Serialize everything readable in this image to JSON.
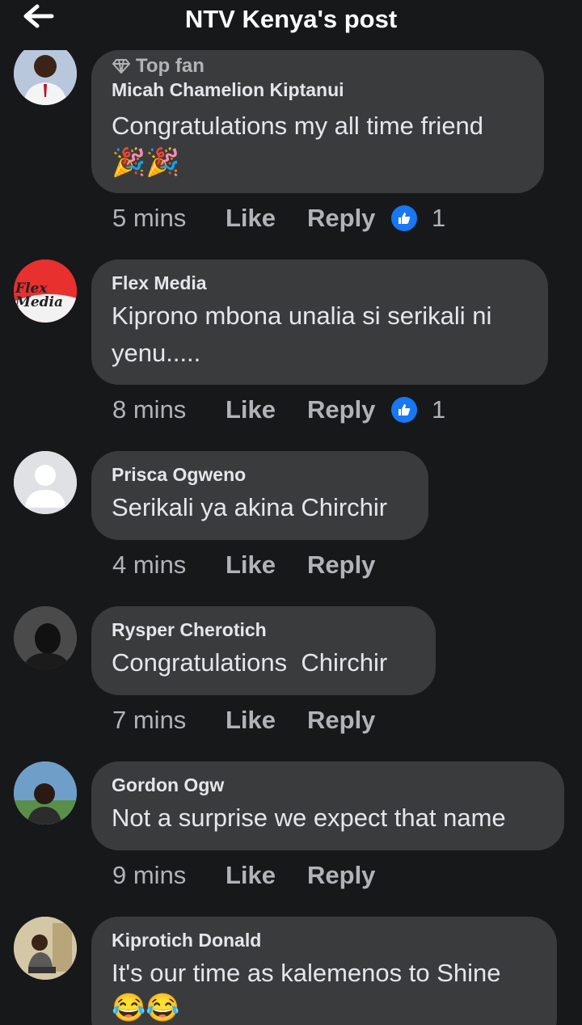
{
  "header": {
    "title": "NTV Kenya's post",
    "back_icon": "arrow-left-icon"
  },
  "comments": [
    {
      "badge": "Top fan",
      "name": "Micah Chamelion Kiptanui",
      "text": "Congratulations my all time friend",
      "emoji": "🎉🎉",
      "time": "5 mins",
      "like": "Like",
      "reply": "Reply",
      "reactions": "1"
    },
    {
      "name": "Flex Media",
      "avatar_text": "Flex Media",
      "text_line1": "Kiprono mbona unalia si serikali ni",
      "text_line2": "yenu.....",
      "time": "8 mins",
      "like": "Like",
      "reply": "Reply",
      "reactions": "1"
    },
    {
      "name": "Prisca Ogweno",
      "text": "Serikali ya akina Chirchir",
      "time": "4 mins",
      "like": "Like",
      "reply": "Reply"
    },
    {
      "name": "Rysper Cherotich",
      "text": "Congratulations  Chirchir",
      "time": "7 mins",
      "like": "Like",
      "reply": "Reply"
    },
    {
      "name": "Gordon Ogw",
      "text": "Not a surprise we expect that name",
      "time": "9 mins",
      "like": "Like",
      "reply": "Reply"
    },
    {
      "name": "Kiprotich Donald",
      "text": "It's our time as kalemenos to Shine",
      "emoji": "😂😂"
    }
  ]
}
